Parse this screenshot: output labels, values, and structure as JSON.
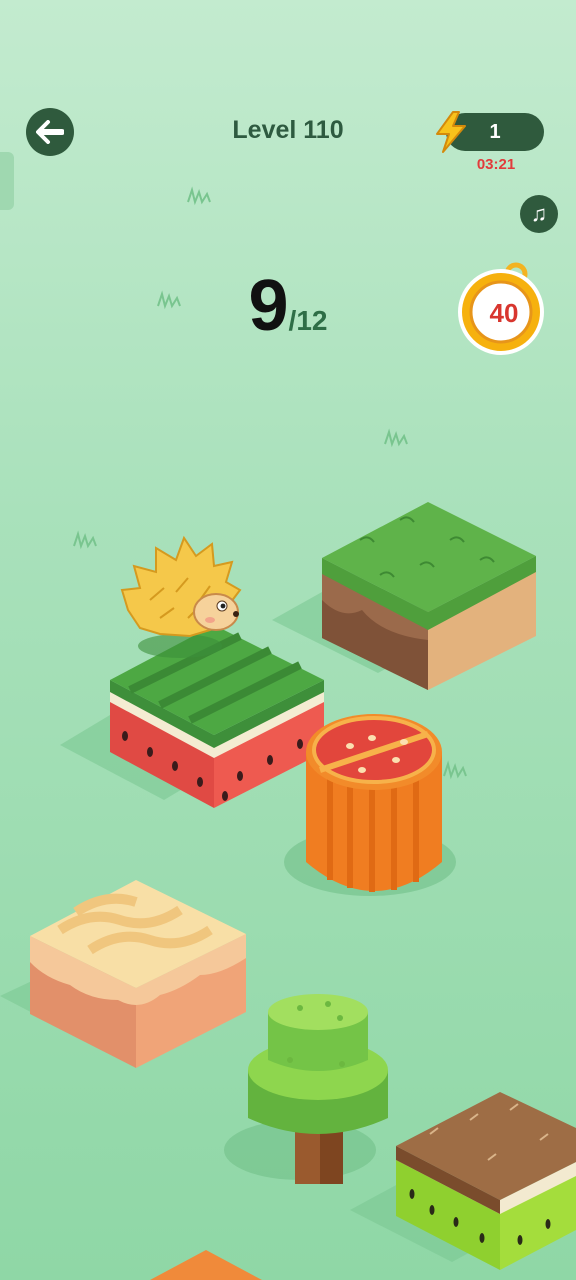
{
  "header": {
    "level_label": "Level 110",
    "energy_count": "1",
    "energy_timer": "03:21"
  },
  "score": {
    "current": "9",
    "total": "/12"
  },
  "timer_badge": {
    "value": "40"
  },
  "icons": {
    "back": "arrow-left-icon",
    "energy": "lightning-bolt-icon",
    "music": "music-note-icon",
    "timer": "stopwatch-icon"
  },
  "colors": {
    "background": "#a9e1bb",
    "hud_dark": "#2f5a3d",
    "timer_red": "#e23b3b",
    "score_green": "#2e6e46"
  },
  "game": {
    "character": "hedgehog",
    "platforms": [
      "watermelon",
      "grass-dirt",
      "orange-slice",
      "wafer-cake",
      "green-tree",
      "kiwi",
      "orange-block"
    ]
  }
}
